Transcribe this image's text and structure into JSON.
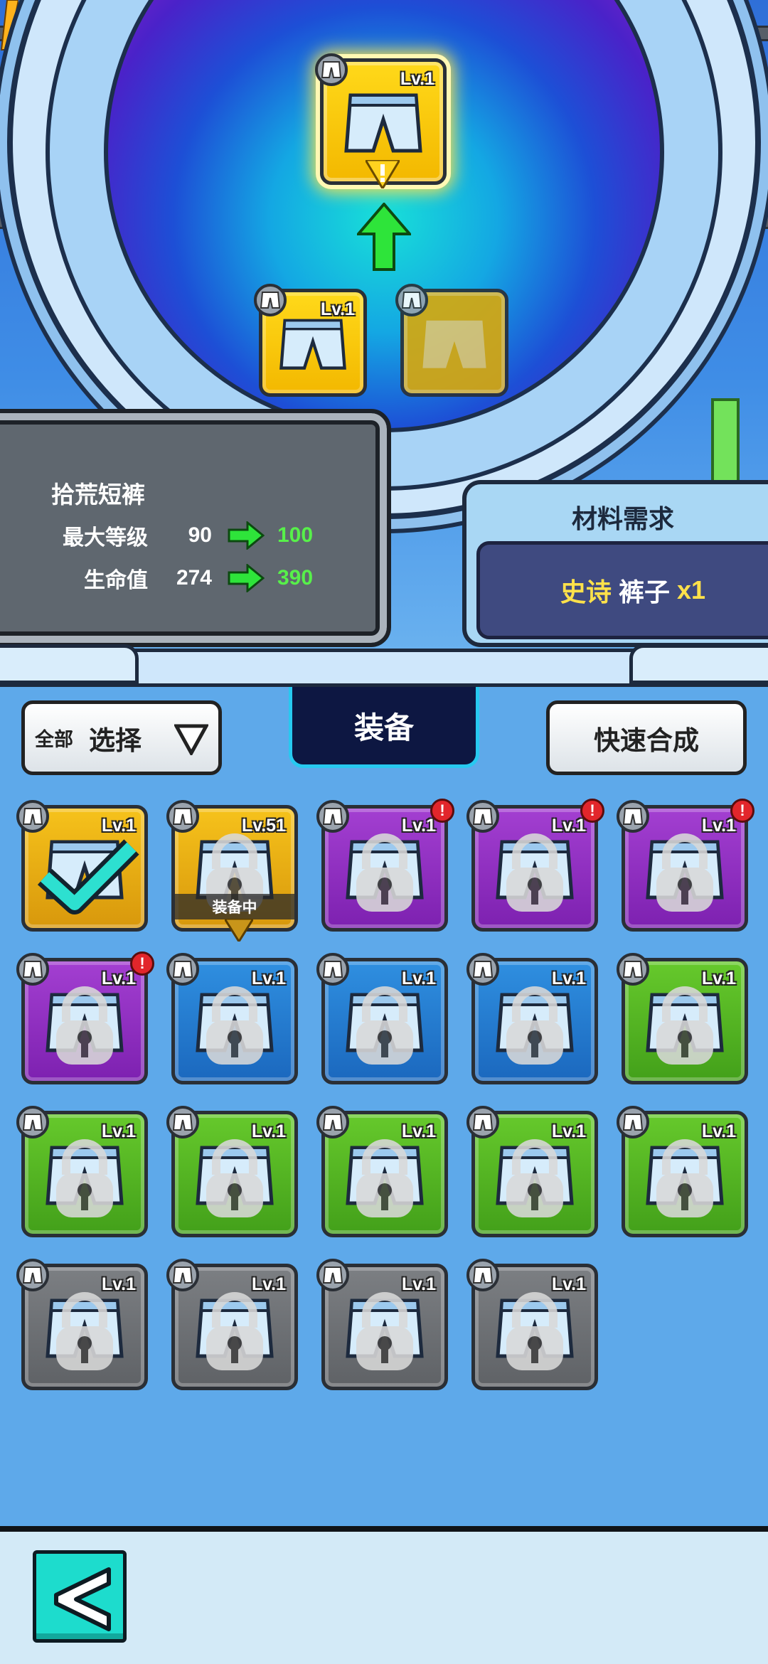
{
  "colors": {
    "rarity_yellow": "#f6c21b",
    "rarity_purple": "#a33fd1",
    "rarity_blue": "#2f8fe0",
    "rarity_green": "#66c92c",
    "rarity_gray": "#7c7f83",
    "stat_increase": "#57f04a",
    "material_highlight": "#ffe14a"
  },
  "forge": {
    "result_level": "Lv.1",
    "ingredient_level": "Lv.1",
    "result_icon": "shorts-icon",
    "slot_icon": "shorts-silhouette-icon"
  },
  "item_info": {
    "name": "拾荒短裤",
    "stats": [
      {
        "label": "最大等级",
        "from": "90",
        "to": "100"
      },
      {
        "label": "生命值",
        "from": "274",
        "to": "390"
      }
    ]
  },
  "materials": {
    "title": "材料需求",
    "rarity": "史诗",
    "item": "裤子",
    "count": "x1"
  },
  "toolbar": {
    "filter_all": "全部",
    "filter_select": "选择",
    "tab_label": "装备",
    "quick_merge_label": "快速合成"
  },
  "inventory": {
    "equipped_label": "装备中",
    "items": [
      {
        "level": "Lv.1",
        "rarity": "yellow",
        "state": "selected",
        "alert": false
      },
      {
        "level": "Lv.51",
        "rarity": "yellow",
        "state": "equipped",
        "alert": false
      },
      {
        "level": "Lv.1",
        "rarity": "purple",
        "state": "locked",
        "alert": true
      },
      {
        "level": "Lv.1",
        "rarity": "purple",
        "state": "locked",
        "alert": true
      },
      {
        "level": "Lv.1",
        "rarity": "purple",
        "state": "locked",
        "alert": true
      },
      {
        "level": "Lv.1",
        "rarity": "purple",
        "state": "locked",
        "alert": true
      },
      {
        "level": "Lv.1",
        "rarity": "blue",
        "state": "locked",
        "alert": false
      },
      {
        "level": "Lv.1",
        "rarity": "blue",
        "state": "locked",
        "alert": false
      },
      {
        "level": "Lv.1",
        "rarity": "blue",
        "state": "locked",
        "alert": false
      },
      {
        "level": "Lv.1",
        "rarity": "green",
        "state": "locked",
        "alert": false
      },
      {
        "level": "Lv.1",
        "rarity": "green",
        "state": "locked",
        "alert": false
      },
      {
        "level": "Lv.1",
        "rarity": "green",
        "state": "locked",
        "alert": false
      },
      {
        "level": "Lv.1",
        "rarity": "green",
        "state": "locked",
        "alert": false
      },
      {
        "level": "Lv.1",
        "rarity": "green",
        "state": "locked",
        "alert": false
      },
      {
        "level": "Lv.1",
        "rarity": "green",
        "state": "locked",
        "alert": false
      },
      {
        "level": "Lv.1",
        "rarity": "gray",
        "state": "locked",
        "alert": false
      },
      {
        "level": "Lv.1",
        "rarity": "gray",
        "state": "locked",
        "alert": false
      },
      {
        "level": "Lv.1",
        "rarity": "gray",
        "state": "locked",
        "alert": false
      },
      {
        "level": "Lv.1",
        "rarity": "gray",
        "state": "locked",
        "alert": false
      }
    ]
  },
  "navigation": {
    "back_icon": "back-arrow-icon"
  }
}
